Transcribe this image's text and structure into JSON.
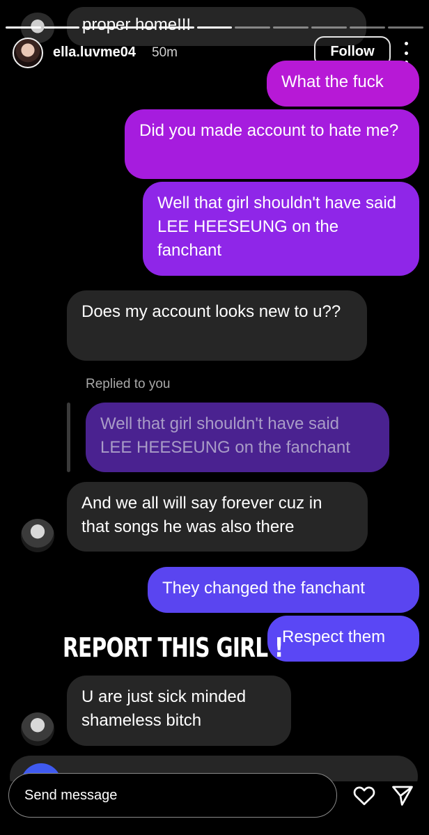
{
  "header": {
    "username": "ella.luvme04",
    "time_ago": "50m",
    "follow_label": "Follow"
  },
  "story": {
    "progress_segments_done": 6,
    "progress_segments_total": 11
  },
  "chat": {
    "top_partial_text": "proper home!!!",
    "messages": [
      {
        "text": "What the fuck"
      },
      {
        "text": "Did you made account to hate me?"
      },
      {
        "text": "Well that girl shouldn't have said LEE HEESEUNG on the fanchant"
      },
      {
        "text": "Does my account looks new to u??"
      },
      {
        "text": "And we all will say forever cuz in that songs he was also there"
      },
      {
        "text": "They changed the fanchant"
      },
      {
        "text": "Respect them"
      },
      {
        "text": "U are just sick minded shameless bitch"
      }
    ],
    "replied_label": "Replied to you",
    "quoted_text": "Well that girl shouldn't have said LEE HEESEUNG on the fanchant"
  },
  "overlay_text": "REPORT THIS GIRL !",
  "footer": {
    "send_placeholder": "Send message"
  },
  "colors": {
    "background": "#000000",
    "incoming_bubble": "#262626",
    "outgoing_pink": "#b719d6",
    "outgoing_violet": "#8f26e8",
    "outgoing_blue": "#5a45f0"
  }
}
